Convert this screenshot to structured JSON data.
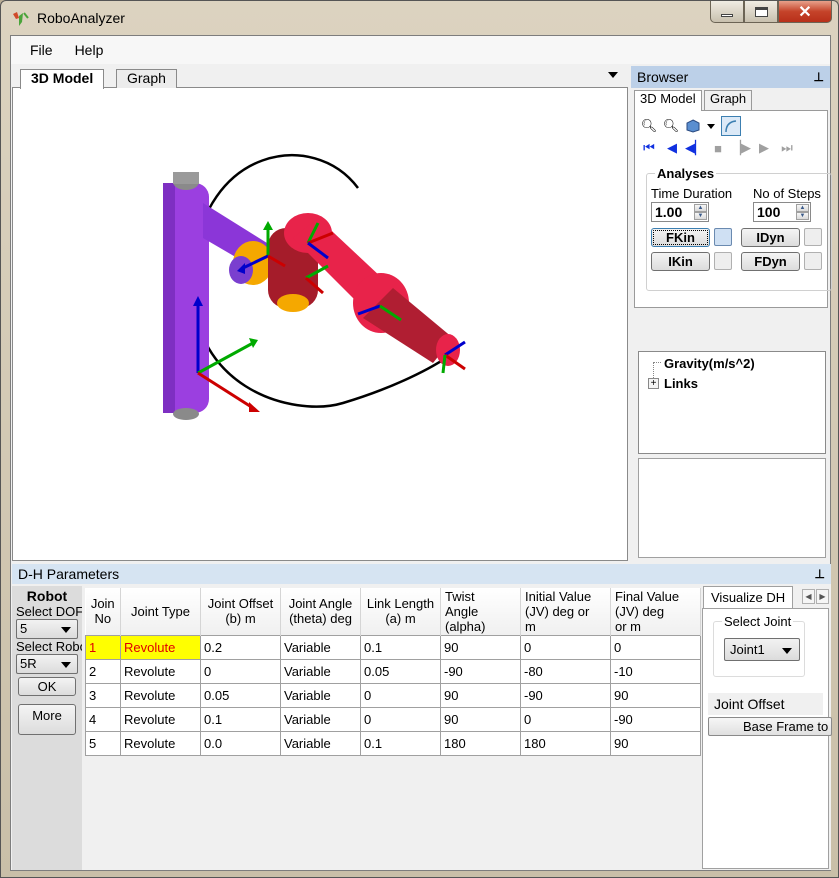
{
  "window": {
    "title": "RoboAnalyzer",
    "controls": [
      "minimize",
      "maximize",
      "close"
    ]
  },
  "menu": {
    "items": [
      {
        "label": "File"
      },
      {
        "label": "Help"
      }
    ]
  },
  "document_tabs": {
    "tabs": [
      {
        "label": "3D Model",
        "active": true
      },
      {
        "label": "Graph",
        "active": false
      }
    ]
  },
  "viewport": {
    "content": "3D robot model, 5R serial manipulator with joint coordinate frames",
    "colors": {
      "base": "#9b3fe0",
      "link_red": "#e8234a",
      "joint_orange": "#f5a800",
      "trajectory": "#000000"
    }
  },
  "browser": {
    "title": "Browser",
    "tabs": [
      {
        "label": "3D Model",
        "active": true
      },
      {
        "label": "Graph",
        "active": false
      }
    ],
    "toolbar_icons": [
      "zoom-in-icon",
      "zoom-out-icon",
      "view-cube-icon",
      "dropdown-icon",
      "trajectory-icon"
    ],
    "playback_icons": [
      "first-frame-icon",
      "step-back-icon",
      "play-back-icon",
      "stop-icon",
      "play-icon",
      "step-forward-icon",
      "last-frame-icon"
    ],
    "analyses": {
      "title": "Analyses",
      "time_duration_label": "Time Duration",
      "time_duration_value": "1.00",
      "steps_label": "No of Steps",
      "steps_value": "100",
      "buttons": [
        {
          "label": "FKin",
          "save_enabled": true
        },
        {
          "label": "IDyn",
          "save_enabled": false
        },
        {
          "label": "IKin",
          "save_enabled": false
        },
        {
          "label": "FDyn",
          "save_enabled": false
        }
      ]
    },
    "tree": {
      "items": [
        {
          "label": "Gravity(m/s^2)",
          "expandable": false
        },
        {
          "label": "Links",
          "expandable": true
        }
      ]
    }
  },
  "dh_panel": {
    "title": "D-H Parameters",
    "robot": {
      "title": "Robot",
      "select_dof_label": "Select DOF",
      "dof_value": "5",
      "select_robot_label": "Select Robot",
      "robot_value": "5R",
      "ok_label": "OK",
      "more_label": "More"
    },
    "table": {
      "headers": [
        "Joint No",
        "Joint Type",
        "Joint Offset (b) m",
        "Joint Angle (theta) deg",
        "Link Length (a) m",
        "Twist Angle (alpha)",
        "Initial Value (JV) deg or m",
        "Final Value (JV) deg or m"
      ],
      "headers_display": [
        "Join\nNo",
        "Joint Type",
        "Joint Offset\n(b)  m",
        "Joint Angle\n(theta)  deg",
        "Link Length\n(a)  m",
        "Twist\nAngle\n(alpha)",
        "Initial Value\n(JV)   deg or\nm",
        "Final Value\n(JV)   deg\nor m"
      ],
      "rows": [
        [
          "1",
          "Revolute",
          "0.2",
          "Variable",
          "0.1",
          "90",
          "0",
          "0"
        ],
        [
          "2",
          "Revolute",
          "0",
          "Variable",
          "0.05",
          "-90",
          "-80",
          "-10"
        ],
        [
          "3",
          "Revolute",
          "0.05",
          "Variable",
          "0",
          "90",
          "-90",
          "90"
        ],
        [
          "4",
          "Revolute",
          "0.1",
          "Variable",
          "0",
          "90",
          "0",
          "-90"
        ],
        [
          "5",
          "Revolute",
          "0.0",
          "Variable",
          "0.1",
          "180",
          "180",
          "90"
        ]
      ],
      "selected_row": 0
    },
    "visualize": {
      "tab_label": "Visualize DH",
      "select_joint_label": "Select Joint",
      "joint_value": "Joint1",
      "joint_offset_label": "Joint Offset",
      "base_frame_label": "Base Frame to"
    }
  }
}
